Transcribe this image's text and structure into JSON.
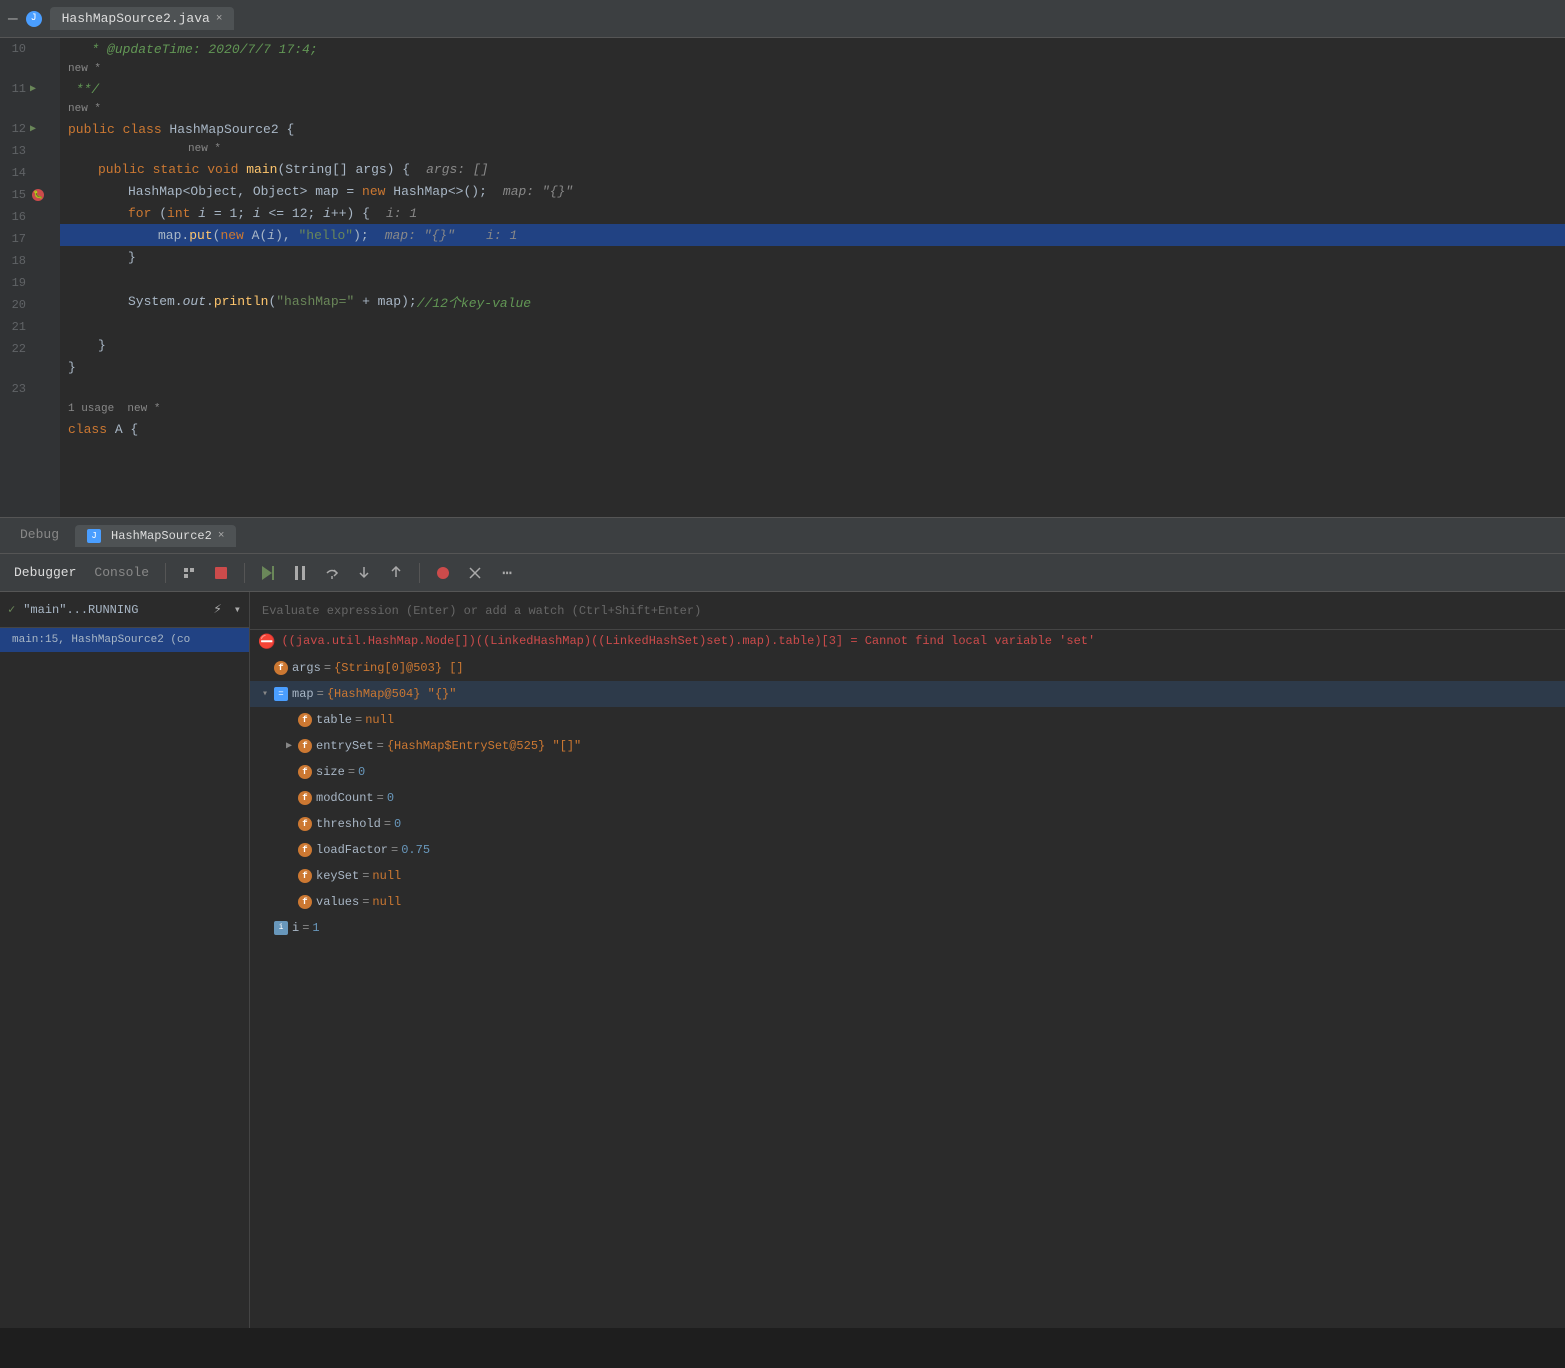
{
  "titlebar": {
    "icon_label": "J",
    "tab_name": "HashMapSource2.java",
    "close_label": "×"
  },
  "debug_tabs": {
    "tab1": "Debug",
    "tab2": "HashMapSource2",
    "close_label": "×"
  },
  "toolbar": {
    "debugger_label": "Debugger",
    "console_label": "Console"
  },
  "frame_panel": {
    "thread_label": "\"main\"...RUNNING",
    "frame_label": "main:15, HashMapSource2 (co"
  },
  "evaluate_bar": {
    "placeholder": "Evaluate expression (Enter) or add a watch (Ctrl+Shift+Enter)"
  },
  "error_entry": {
    "text": "((java.util.HashMap.Node[])((LinkedHashMap)((LinkedHashSet)set).map).table)[3] = Cannot find local variable 'set'"
  },
  "variables": {
    "args_name": "args",
    "args_value": "{String[0]@503} []",
    "map_name": "map",
    "map_value": "{HashMap@504} \"{}\"",
    "table_name": "table",
    "table_value": "null",
    "entrySet_name": "entrySet",
    "entrySet_value": "{HashMap$EntrySet@525} \"[]\"",
    "size_name": "size",
    "size_value": "0",
    "modCount_name": "modCount",
    "modCount_value": "0",
    "threshold_name": "threshold",
    "threshold_value": "0",
    "loadFactor_name": "loadFactor",
    "loadFactor_value": "0.75",
    "keySet_name": "keySet",
    "keySet_value": "null",
    "values_name": "values",
    "values_value": "null",
    "i_name": "i",
    "i_value": "1"
  },
  "code_lines": {
    "l10_content": " **/",
    "l10_hint": "",
    "new_label": "new *",
    "l11_content": "public class HashMapSource2 {",
    "l11_hint": "new *",
    "l12_content": "    public static void main(String[] args) {",
    "l12_hint": "args: []",
    "l13_content": "        HashMap<Object, Object> map = new HashMap<>();",
    "l13_hint": "map: \"{}\"",
    "l14_content": "        for (int i = 1; i <= 12; i++) {",
    "l14_hint": "i: 1",
    "l15_content": "            map.put(new A(i), \"hello\");",
    "l15_hint": "map: \"{}\"    i: 1",
    "l16_content": "        }",
    "l17_content": "",
    "l18_content": "        System.out.println(\"hashMap=\" + map);//12个key-value",
    "l19_content": "",
    "l20_content": "    }",
    "l21_content": "}",
    "l22_content": "",
    "usage_label": "1 usage  new *",
    "l23_content": "class A {"
  }
}
